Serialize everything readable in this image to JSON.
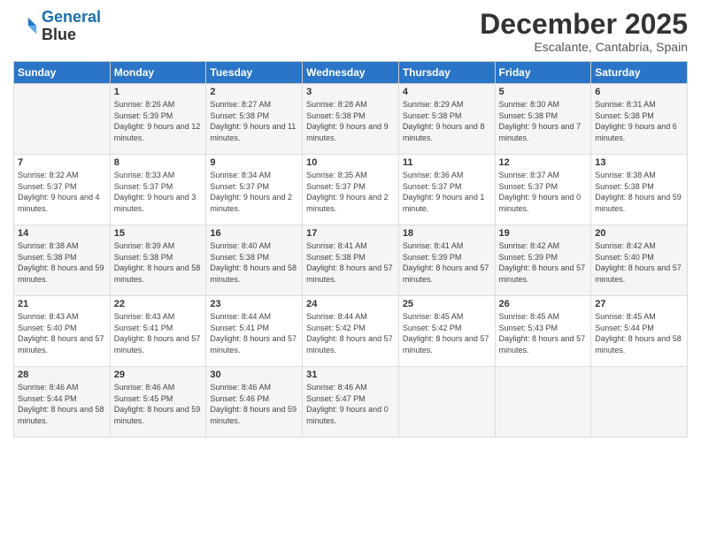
{
  "logo": {
    "line1": "General",
    "line2": "Blue"
  },
  "title": "December 2025",
  "location": "Escalante, Cantabria, Spain",
  "headers": [
    "Sunday",
    "Monday",
    "Tuesday",
    "Wednesday",
    "Thursday",
    "Friday",
    "Saturday"
  ],
  "weeks": [
    [
      {
        "day": "",
        "sunrise": "",
        "sunset": "",
        "daylight": ""
      },
      {
        "day": "1",
        "sunrise": "Sunrise: 8:26 AM",
        "sunset": "Sunset: 5:39 PM",
        "daylight": "Daylight: 9 hours and 12 minutes."
      },
      {
        "day": "2",
        "sunrise": "Sunrise: 8:27 AM",
        "sunset": "Sunset: 5:38 PM",
        "daylight": "Daylight: 9 hours and 11 minutes."
      },
      {
        "day": "3",
        "sunrise": "Sunrise: 8:28 AM",
        "sunset": "Sunset: 5:38 PM",
        "daylight": "Daylight: 9 hours and 9 minutes."
      },
      {
        "day": "4",
        "sunrise": "Sunrise: 8:29 AM",
        "sunset": "Sunset: 5:38 PM",
        "daylight": "Daylight: 9 hours and 8 minutes."
      },
      {
        "day": "5",
        "sunrise": "Sunrise: 8:30 AM",
        "sunset": "Sunset: 5:38 PM",
        "daylight": "Daylight: 9 hours and 7 minutes."
      },
      {
        "day": "6",
        "sunrise": "Sunrise: 8:31 AM",
        "sunset": "Sunset: 5:38 PM",
        "daylight": "Daylight: 9 hours and 6 minutes."
      }
    ],
    [
      {
        "day": "7",
        "sunrise": "Sunrise: 8:32 AM",
        "sunset": "Sunset: 5:37 PM",
        "daylight": "Daylight: 9 hours and 4 minutes."
      },
      {
        "day": "8",
        "sunrise": "Sunrise: 8:33 AM",
        "sunset": "Sunset: 5:37 PM",
        "daylight": "Daylight: 9 hours and 3 minutes."
      },
      {
        "day": "9",
        "sunrise": "Sunrise: 8:34 AM",
        "sunset": "Sunset: 5:37 PM",
        "daylight": "Daylight: 9 hours and 2 minutes."
      },
      {
        "day": "10",
        "sunrise": "Sunrise: 8:35 AM",
        "sunset": "Sunset: 5:37 PM",
        "daylight": "Daylight: 9 hours and 2 minutes."
      },
      {
        "day": "11",
        "sunrise": "Sunrise: 8:36 AM",
        "sunset": "Sunset: 5:37 PM",
        "daylight": "Daylight: 9 hours and 1 minute."
      },
      {
        "day": "12",
        "sunrise": "Sunrise: 8:37 AM",
        "sunset": "Sunset: 5:37 PM",
        "daylight": "Daylight: 9 hours and 0 minutes."
      },
      {
        "day": "13",
        "sunrise": "Sunrise: 8:38 AM",
        "sunset": "Sunset: 5:38 PM",
        "daylight": "Daylight: 8 hours and 59 minutes."
      }
    ],
    [
      {
        "day": "14",
        "sunrise": "Sunrise: 8:38 AM",
        "sunset": "Sunset: 5:38 PM",
        "daylight": "Daylight: 8 hours and 59 minutes."
      },
      {
        "day": "15",
        "sunrise": "Sunrise: 8:39 AM",
        "sunset": "Sunset: 5:38 PM",
        "daylight": "Daylight: 8 hours and 58 minutes."
      },
      {
        "day": "16",
        "sunrise": "Sunrise: 8:40 AM",
        "sunset": "Sunset: 5:38 PM",
        "daylight": "Daylight: 8 hours and 58 minutes."
      },
      {
        "day": "17",
        "sunrise": "Sunrise: 8:41 AM",
        "sunset": "Sunset: 5:38 PM",
        "daylight": "Daylight: 8 hours and 57 minutes."
      },
      {
        "day": "18",
        "sunrise": "Sunrise: 8:41 AM",
        "sunset": "Sunset: 5:39 PM",
        "daylight": "Daylight: 8 hours and 57 minutes."
      },
      {
        "day": "19",
        "sunrise": "Sunrise: 8:42 AM",
        "sunset": "Sunset: 5:39 PM",
        "daylight": "Daylight: 8 hours and 57 minutes."
      },
      {
        "day": "20",
        "sunrise": "Sunrise: 8:42 AM",
        "sunset": "Sunset: 5:40 PM",
        "daylight": "Daylight: 8 hours and 57 minutes."
      }
    ],
    [
      {
        "day": "21",
        "sunrise": "Sunrise: 8:43 AM",
        "sunset": "Sunset: 5:40 PM",
        "daylight": "Daylight: 8 hours and 57 minutes."
      },
      {
        "day": "22",
        "sunrise": "Sunrise: 8:43 AM",
        "sunset": "Sunset: 5:41 PM",
        "daylight": "Daylight: 8 hours and 57 minutes."
      },
      {
        "day": "23",
        "sunrise": "Sunrise: 8:44 AM",
        "sunset": "Sunset: 5:41 PM",
        "daylight": "Daylight: 8 hours and 57 minutes."
      },
      {
        "day": "24",
        "sunrise": "Sunrise: 8:44 AM",
        "sunset": "Sunset: 5:42 PM",
        "daylight": "Daylight: 8 hours and 57 minutes."
      },
      {
        "day": "25",
        "sunrise": "Sunrise: 8:45 AM",
        "sunset": "Sunset: 5:42 PM",
        "daylight": "Daylight: 8 hours and 57 minutes."
      },
      {
        "day": "26",
        "sunrise": "Sunrise: 8:45 AM",
        "sunset": "Sunset: 5:43 PM",
        "daylight": "Daylight: 8 hours and 57 minutes."
      },
      {
        "day": "27",
        "sunrise": "Sunrise: 8:45 AM",
        "sunset": "Sunset: 5:44 PM",
        "daylight": "Daylight: 8 hours and 58 minutes."
      }
    ],
    [
      {
        "day": "28",
        "sunrise": "Sunrise: 8:46 AM",
        "sunset": "Sunset: 5:44 PM",
        "daylight": "Daylight: 8 hours and 58 minutes."
      },
      {
        "day": "29",
        "sunrise": "Sunrise: 8:46 AM",
        "sunset": "Sunset: 5:45 PM",
        "daylight": "Daylight: 8 hours and 59 minutes."
      },
      {
        "day": "30",
        "sunrise": "Sunrise: 8:46 AM",
        "sunset": "Sunset: 5:46 PM",
        "daylight": "Daylight: 8 hours and 59 minutes."
      },
      {
        "day": "31",
        "sunrise": "Sunrise: 8:46 AM",
        "sunset": "Sunset: 5:47 PM",
        "daylight": "Daylight: 9 hours and 0 minutes."
      },
      {
        "day": "",
        "sunrise": "",
        "sunset": "",
        "daylight": ""
      },
      {
        "day": "",
        "sunrise": "",
        "sunset": "",
        "daylight": ""
      },
      {
        "day": "",
        "sunrise": "",
        "sunset": "",
        "daylight": ""
      }
    ]
  ]
}
